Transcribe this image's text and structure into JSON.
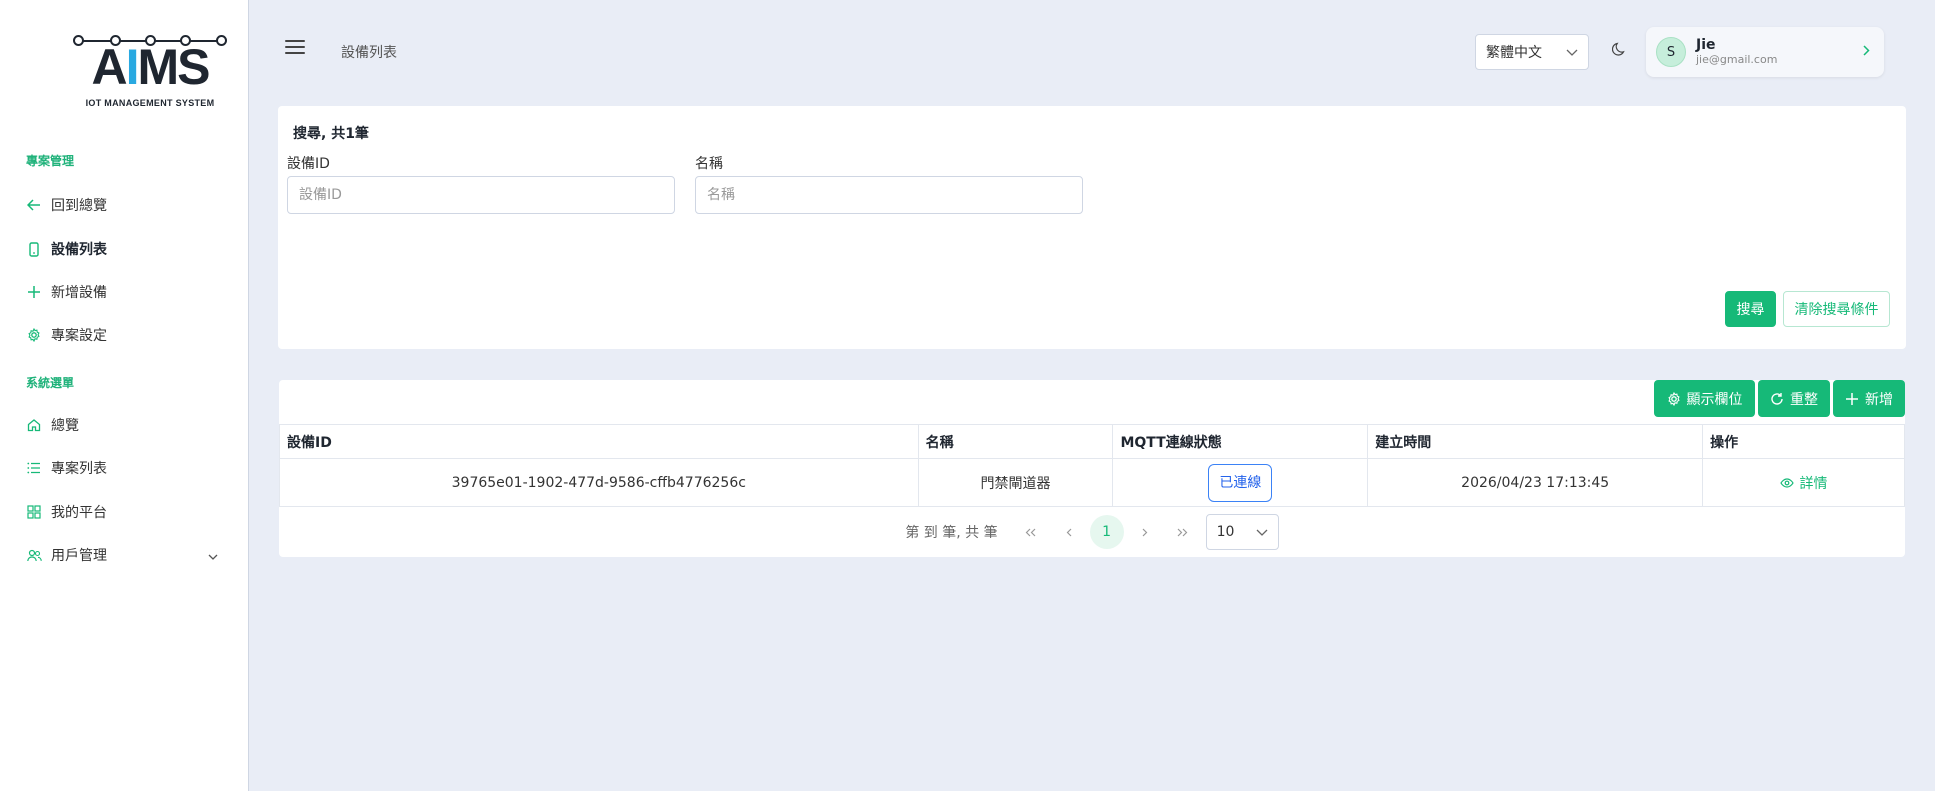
{
  "brand": {
    "logo_text_a": "A",
    "logo_text_i": "I",
    "logo_text_ms": "MS",
    "logo_sub": "IOT MANAGEMENT SYSTEM"
  },
  "sidebar": {
    "section_project": "專案管理",
    "project_items": [
      {
        "label": "回到總覽",
        "icon": "arrow-left-icon"
      },
      {
        "label": "設備列表",
        "icon": "device-icon"
      },
      {
        "label": "新增設備",
        "icon": "plus-icon"
      },
      {
        "label": "專案設定",
        "icon": "gear-icon"
      }
    ],
    "section_system": "系統選單",
    "system_items": [
      {
        "label": "總覽",
        "icon": "home-icon"
      },
      {
        "label": "專案列表",
        "icon": "list-icon"
      },
      {
        "label": "我的平台",
        "icon": "grid-icon"
      },
      {
        "label": "用戶管理",
        "icon": "users-icon"
      }
    ]
  },
  "header": {
    "breadcrumb": "設備列表",
    "language": "繁體中文",
    "user": {
      "initial": "S",
      "name": "Jie",
      "email": "jie@gmail.com"
    }
  },
  "search": {
    "title": "搜尋, 共1筆",
    "device_id_label": "設備ID",
    "device_id_placeholder": "設備ID",
    "device_id_value": "",
    "name_label": "名稱",
    "name_placeholder": "名稱",
    "name_value": "",
    "search_button": "搜尋",
    "clear_button": "清除搜尋條件"
  },
  "table": {
    "toolbar": {
      "columns_button": "顯示欄位",
      "reset_button": "重整",
      "add_button": "新增"
    },
    "columns": [
      "設備ID",
      "名稱",
      "MQTT連線狀態",
      "建立時間",
      "操作"
    ],
    "rows": [
      {
        "device_id": "39765e01-1902-477d-9586-cffb4776256c",
        "name": "門禁閘道器",
        "status": "已連線",
        "created": "2026/04/23 17:13:45",
        "action": "詳情"
      }
    ],
    "pagination": {
      "summary": "第 到 筆, 共 筆",
      "current_page": "1",
      "page_size": "10"
    }
  },
  "colors": {
    "primary": "#16b978",
    "status_blue": "#2563eb",
    "background": "#e9edf6"
  }
}
